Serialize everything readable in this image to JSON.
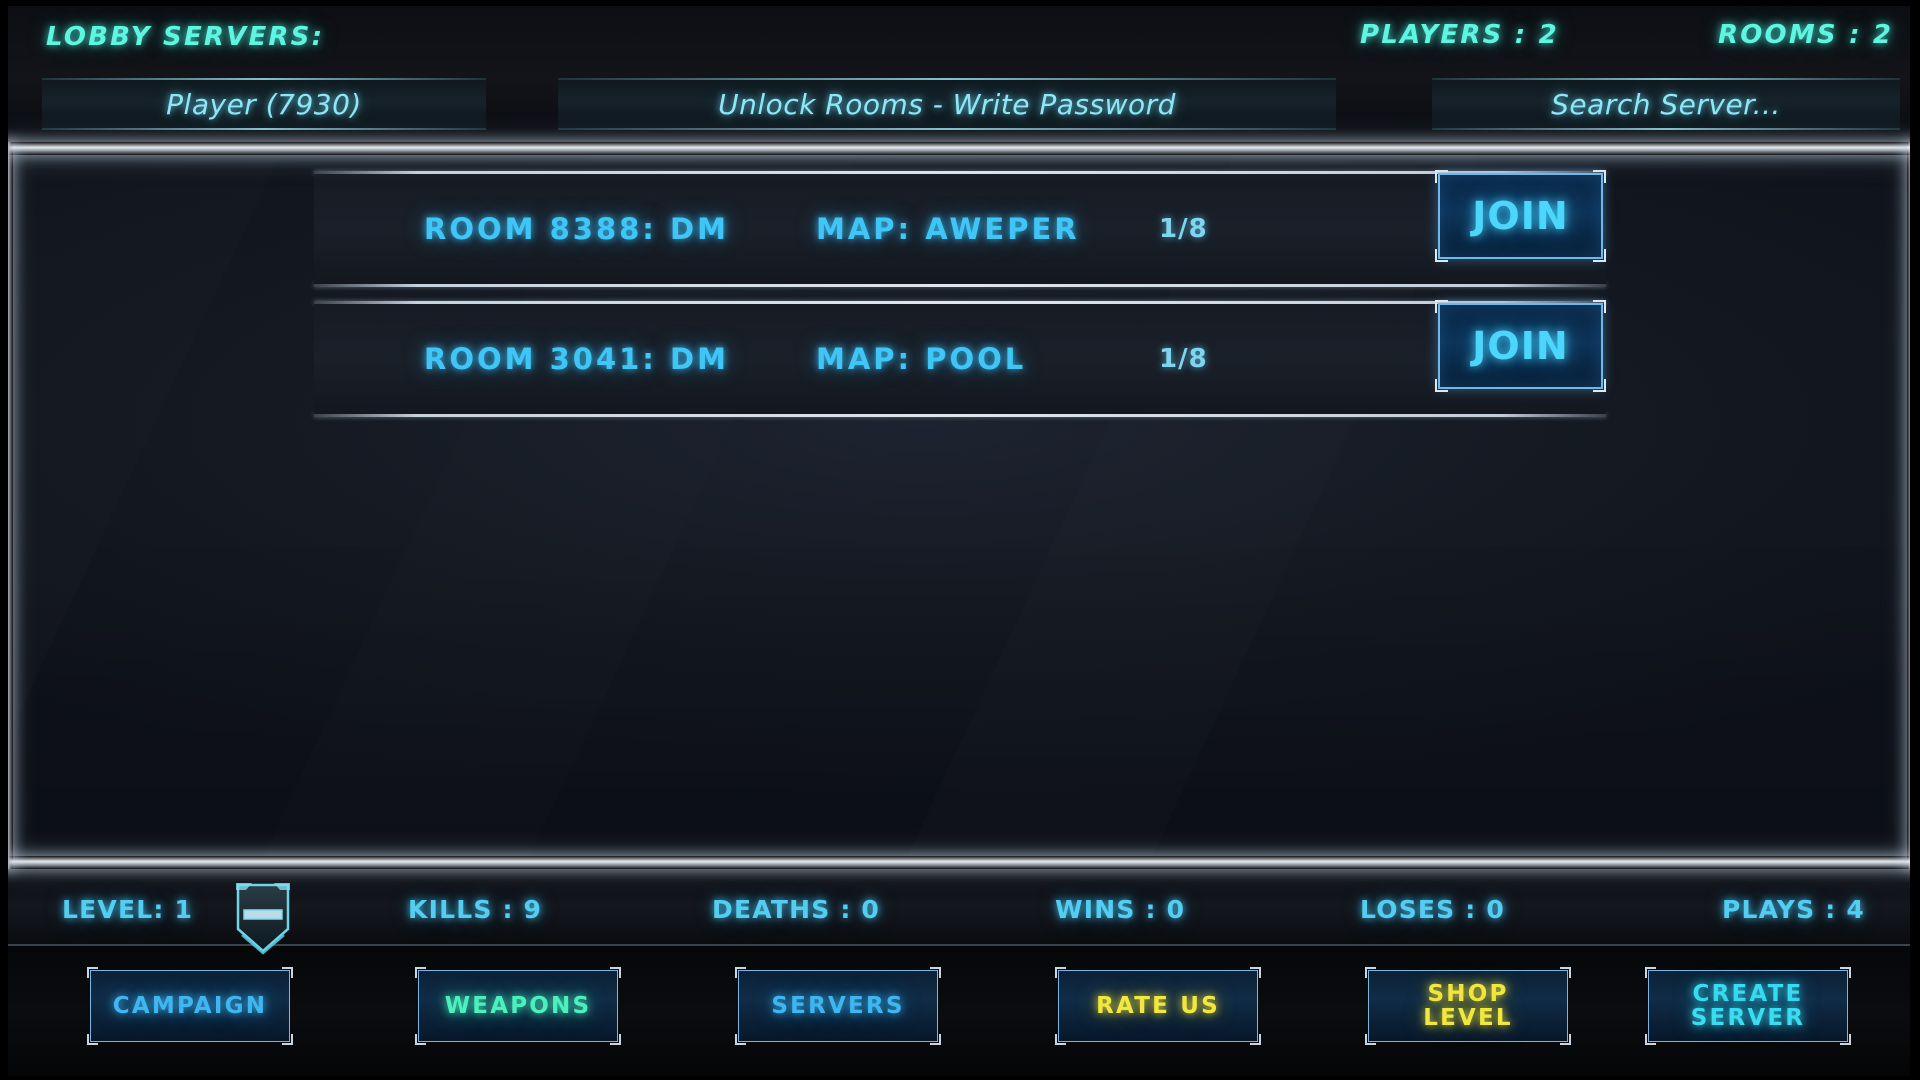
{
  "header": {
    "lobby_title": "LOBBY SERVERS:",
    "players_label": "PLAYERS : 2",
    "rooms_label": "ROOMS : 2",
    "fields": {
      "player": {
        "value": "Player (7930)",
        "name": "player-name-field"
      },
      "password": {
        "value": "Unlock Rooms - Write Password",
        "name": "password-field"
      },
      "search": {
        "value": "Search  Server...",
        "name": "search-server-field"
      }
    }
  },
  "server_list": {
    "join_label": "JOIN",
    "rows": [
      {
        "room": "ROOM 8388: DM",
        "map": "MAP: AWEPER",
        "slots": "1/8",
        "join": "JOIN"
      },
      {
        "room": "ROOM 3041: DM",
        "map": "MAP: POOL",
        "slots": "1/8",
        "join": "JOIN"
      }
    ]
  },
  "stats": {
    "level": "LEVEL: 1",
    "kills": "KILLS : 9",
    "deaths": "DEATHS : 0",
    "wins": "WINS : 0",
    "loses": "LOSES : 0",
    "plays": "PLAYS : 4",
    "rank_badge_icon": "shield-rank-icon"
  },
  "nav": {
    "buttons": [
      {
        "line1": "CAMPAIGN",
        "line2": "",
        "color": "blue"
      },
      {
        "line1": "WEAPONS",
        "line2": "",
        "color": "green"
      },
      {
        "line1": "SERVERS",
        "line2": "",
        "color": "blue"
      },
      {
        "line1": "RATE US",
        "line2": "",
        "color": "yellow"
      },
      {
        "line1": "SHOP",
        "line2": "LEVEL",
        "color": "yellow"
      },
      {
        "line1": "CREATE",
        "line2": "SERVER",
        "color": "cyan"
      }
    ]
  },
  "colors": {
    "accent_cyan": "#3fc6f7",
    "accent_teal": "#5ff5e0",
    "accent_yellow": "#f2e73f",
    "accent_green": "#4df0bd",
    "panel_bg": "#151a23",
    "frame": "#e8ecf0"
  }
}
